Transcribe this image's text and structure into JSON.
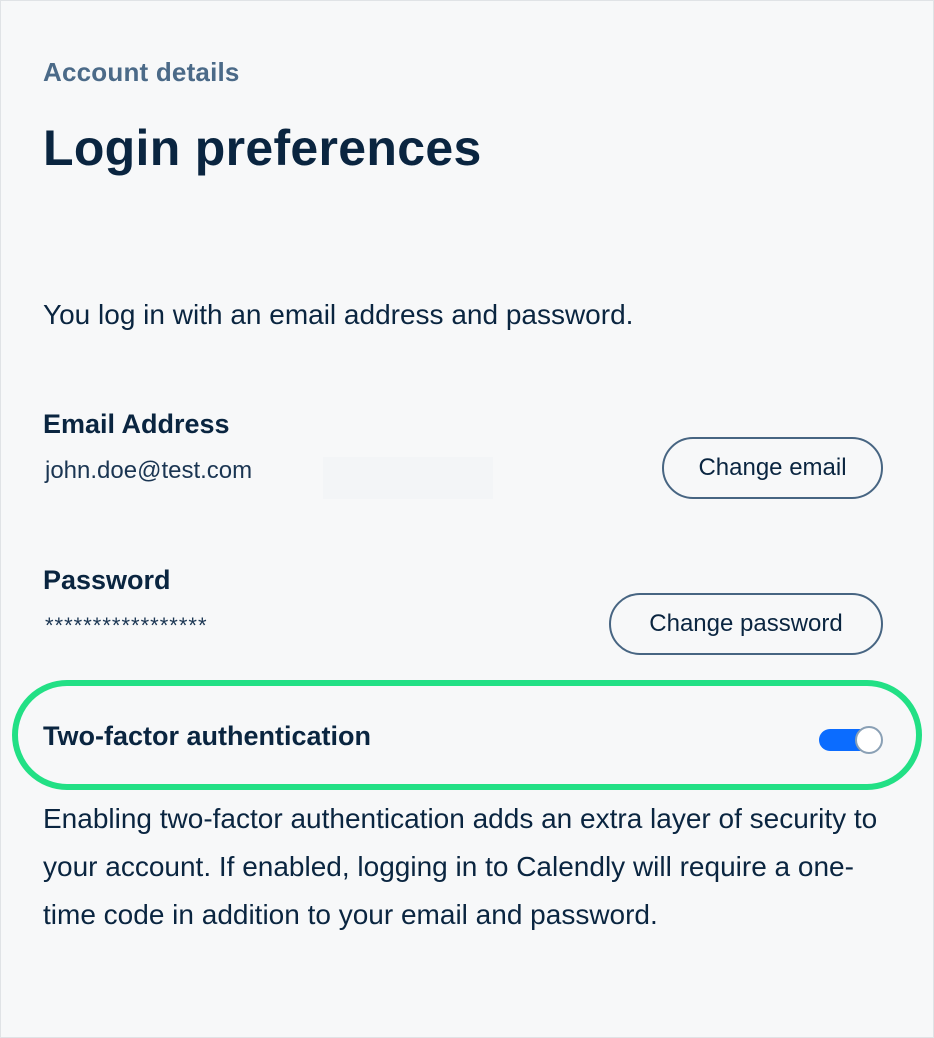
{
  "header": {
    "breadcrumb": "Account details",
    "title": "Login preferences"
  },
  "intro": {
    "text": "You log in with an email address and password."
  },
  "email": {
    "label": "Email Address",
    "value": "john.doe@test.com",
    "button_label": "Change email"
  },
  "password": {
    "label": "Password",
    "value": "*****************",
    "button_label": "Change password"
  },
  "two_factor": {
    "label": "Two-factor authentication",
    "enabled": true,
    "description": "Enabling two-factor authentication adds an extra layer of security to your account. If enabled, logging in to Calendly will require a one-time code in addition to your email and password."
  },
  "colors": {
    "accent_toggle": "#0b6cff",
    "highlight": "#22e085",
    "text_primary": "#0a2540",
    "breadcrumb": "#4b6a88"
  }
}
